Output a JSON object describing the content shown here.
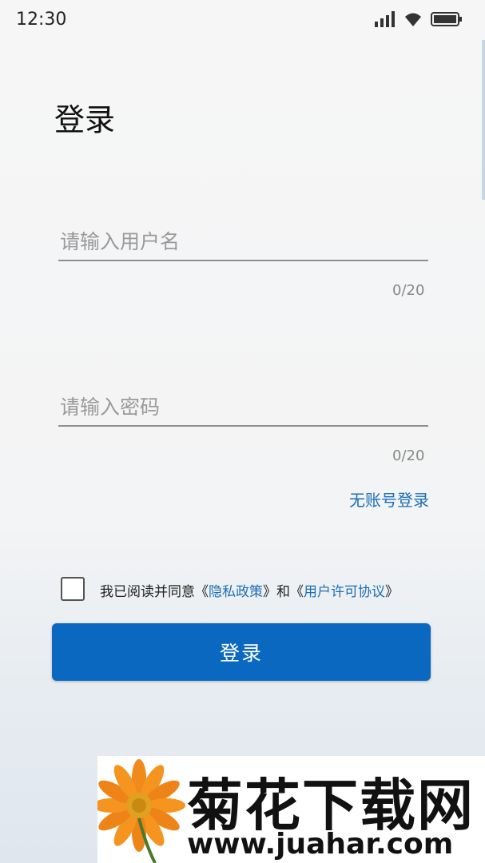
{
  "status_bar": {
    "time": "12:30"
  },
  "header": {
    "title": "登录"
  },
  "username": {
    "placeholder": "请输入用户名",
    "value": "",
    "counter": "0/20"
  },
  "password": {
    "placeholder": "请输入密码",
    "value": "",
    "counter": "0/20"
  },
  "no_account_link": "无账号登录",
  "agreement": {
    "prefix": "我已阅读并同意《",
    "privacy": "隐私政策",
    "middle": "》和《",
    "license": "用户许可协议",
    "suffix": "》",
    "checked": false
  },
  "login_button": "登录",
  "watermark": {
    "title": "菊花下载网",
    "url": "www.juahar.com"
  },
  "colors": {
    "primary": "#0b68c1",
    "link": "#1a6eb8"
  }
}
